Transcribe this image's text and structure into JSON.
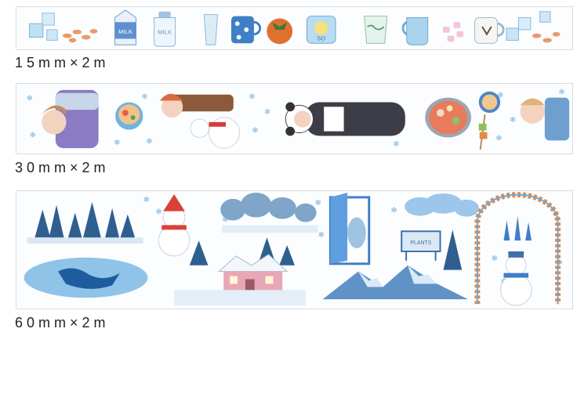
{
  "tapes": [
    {
      "label": "15mm×2m"
    },
    {
      "label": "30mm×2m"
    },
    {
      "label": "60mm×2m"
    }
  ],
  "illustration_text": {
    "milk_carton": "MILK",
    "milk_bottle": "MILK",
    "can": "SO",
    "sign": "PLANTS"
  }
}
